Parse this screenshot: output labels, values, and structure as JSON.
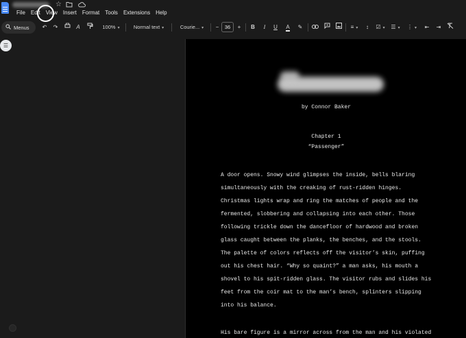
{
  "menubar": {
    "items": [
      "File",
      "Edit",
      "View",
      "Insert",
      "Format",
      "Tools",
      "Extensions",
      "Help"
    ]
  },
  "titlebar_icons": [
    "star-icon",
    "folder-move-icon",
    "cloud-status-icon"
  ],
  "toolbar": {
    "search_label": "Menus",
    "zoom": "100%",
    "style": "Normal text",
    "font": "Courie...",
    "font_size": "36",
    "minus": "−",
    "plus": "+"
  },
  "document": {
    "byline": "by Connor Baker",
    "chapter": "Chapter 1",
    "chapter_subtitle": "“Passenger”",
    "paragraph1": [
      "A door opens. Snowy wind glimpses the inside, bells blaring",
      "simultaneously with the creaking of rust-ridden hinges.",
      "Christmas lights wrap and ring the matches of people and the",
      "fermented, slobbering and collapsing into each other. Those",
      "following trickle down the dancefloor of hardwood and broken",
      "glass caught between the planks, the benches, and the stools.",
      "The palette of colors reflects off the visitor’s skin, puffing",
      "out his chest hair. “Why so quaint?” a man asks, his mouth a",
      "shovel to his spit-ridden glass. The visitor rubs and slides his",
      "feet from the coir mat to the man’s bench, splinters slipping",
      "into his balance."
    ],
    "paragraph2": [
      "His bare figure is a mirror across from the man and his violated"
    ]
  }
}
